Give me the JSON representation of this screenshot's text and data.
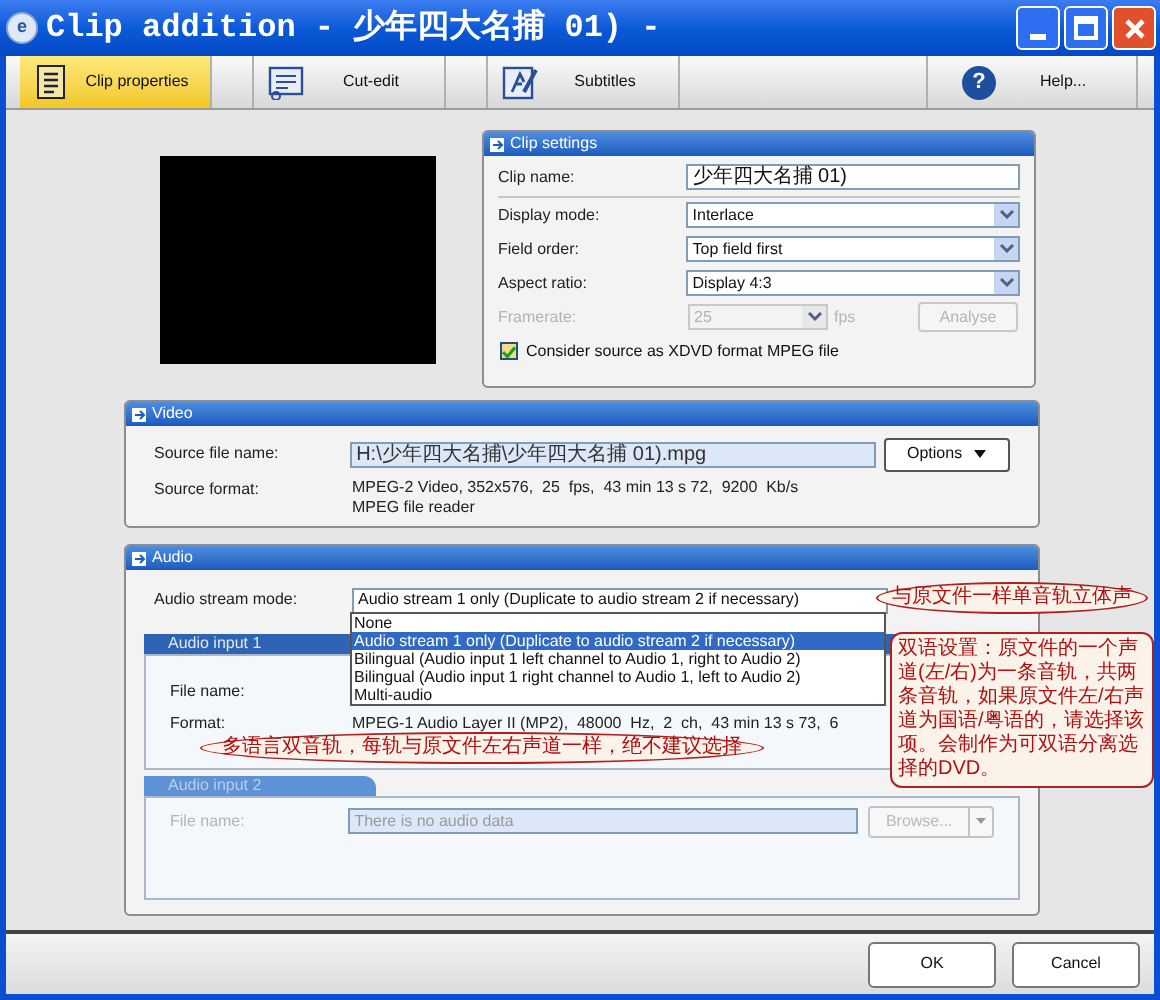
{
  "window": {
    "title": "Clip addition - 少年四大名捕 01) -",
    "icon_glyph": "e"
  },
  "tabs": [
    {
      "label": "Clip properties",
      "selected": true
    },
    {
      "label": "Cut-edit",
      "selected": false
    },
    {
      "label": "Subtitles",
      "selected": false
    }
  ],
  "help_button": {
    "label": "Help...",
    "icon_glyph": "?"
  },
  "clip_settings": {
    "title": "Clip settings",
    "fields": [
      {
        "kind": "text",
        "label": "Clip name:",
        "value": "少年四大名捕 01)"
      },
      {
        "kind": "select",
        "label": "Display mode:",
        "value": "Interlace"
      },
      {
        "kind": "select",
        "label": "Field order:",
        "value": "Top field first"
      },
      {
        "kind": "select",
        "label": "Aspect ratio:",
        "value": "Display 4:3"
      }
    ],
    "framerate": {
      "label": "Framerate:",
      "value": "25",
      "unit": "fps",
      "disabled": true
    },
    "analyse_button": {
      "label": "Analyse",
      "disabled": true
    },
    "xdvd_checkbox": {
      "label": "Consider source as XDVD format MPEG file",
      "checked": true
    }
  },
  "video": {
    "title": "Video",
    "source_file_label": "Source file name:",
    "source_file": "H:\\少年四大名捕\\少年四大名捕 01).mpg",
    "options_button": "Options",
    "source_format_label": "Source format:",
    "source_format": [
      "MPEG-2 Video, 352x576,  25  fps,  43 min 13 s 72,  9200  Kb/s",
      "MPEG file reader"
    ]
  },
  "audio": {
    "title": "Audio",
    "stream_mode_label": "Audio stream mode:",
    "stream_mode": "Audio stream 1 only (Duplicate to audio stream 2 if necessary)",
    "expanded": true,
    "options": [
      {
        "label": "None",
        "selected": false
      },
      {
        "label": "Audio stream 1 only (Duplicate to audio stream 2 if necessary)",
        "selected": true
      },
      {
        "label": "Bilingual (Audio input 1 left channel to Audio 1, right to Audio 2)",
        "selected": false
      },
      {
        "label": "Bilingual (Audio input 1 right channel to Audio 1, left to Audio 2)",
        "selected": false
      },
      {
        "label": "Multi-audio",
        "selected": false
      }
    ],
    "inputs": [
      {
        "title": "Audio input 1",
        "disabled": false,
        "file_label": "File name:",
        "format_label": "Format:",
        "format": "MPEG-1 Audio Layer II (MP2),  48000  Hz,  2  ch,  43 min 13 s 73,  6"
      },
      {
        "title": "Audio input 2",
        "disabled": true,
        "file_label": "File name:",
        "file_value": "There is no audio data",
        "browse": "Browse..."
      }
    ]
  },
  "annotations": [
    {
      "kind": "ellipse",
      "text": "与原文件一样单音轨立体声"
    },
    {
      "kind": "box",
      "text": "双语设置：原文件的一个声道(左/右)为一条音轨，共两条音轨，如果原文件左/右声道为国语/粤语的，请选择该项。会制作为可双语分离选择的DVD。"
    },
    {
      "kind": "ellipse",
      "text": "多语言双音轨，每轨与原文件左右声道一样，绝不建议选择"
    }
  ],
  "buttons": [
    "OK",
    "Cancel"
  ]
}
